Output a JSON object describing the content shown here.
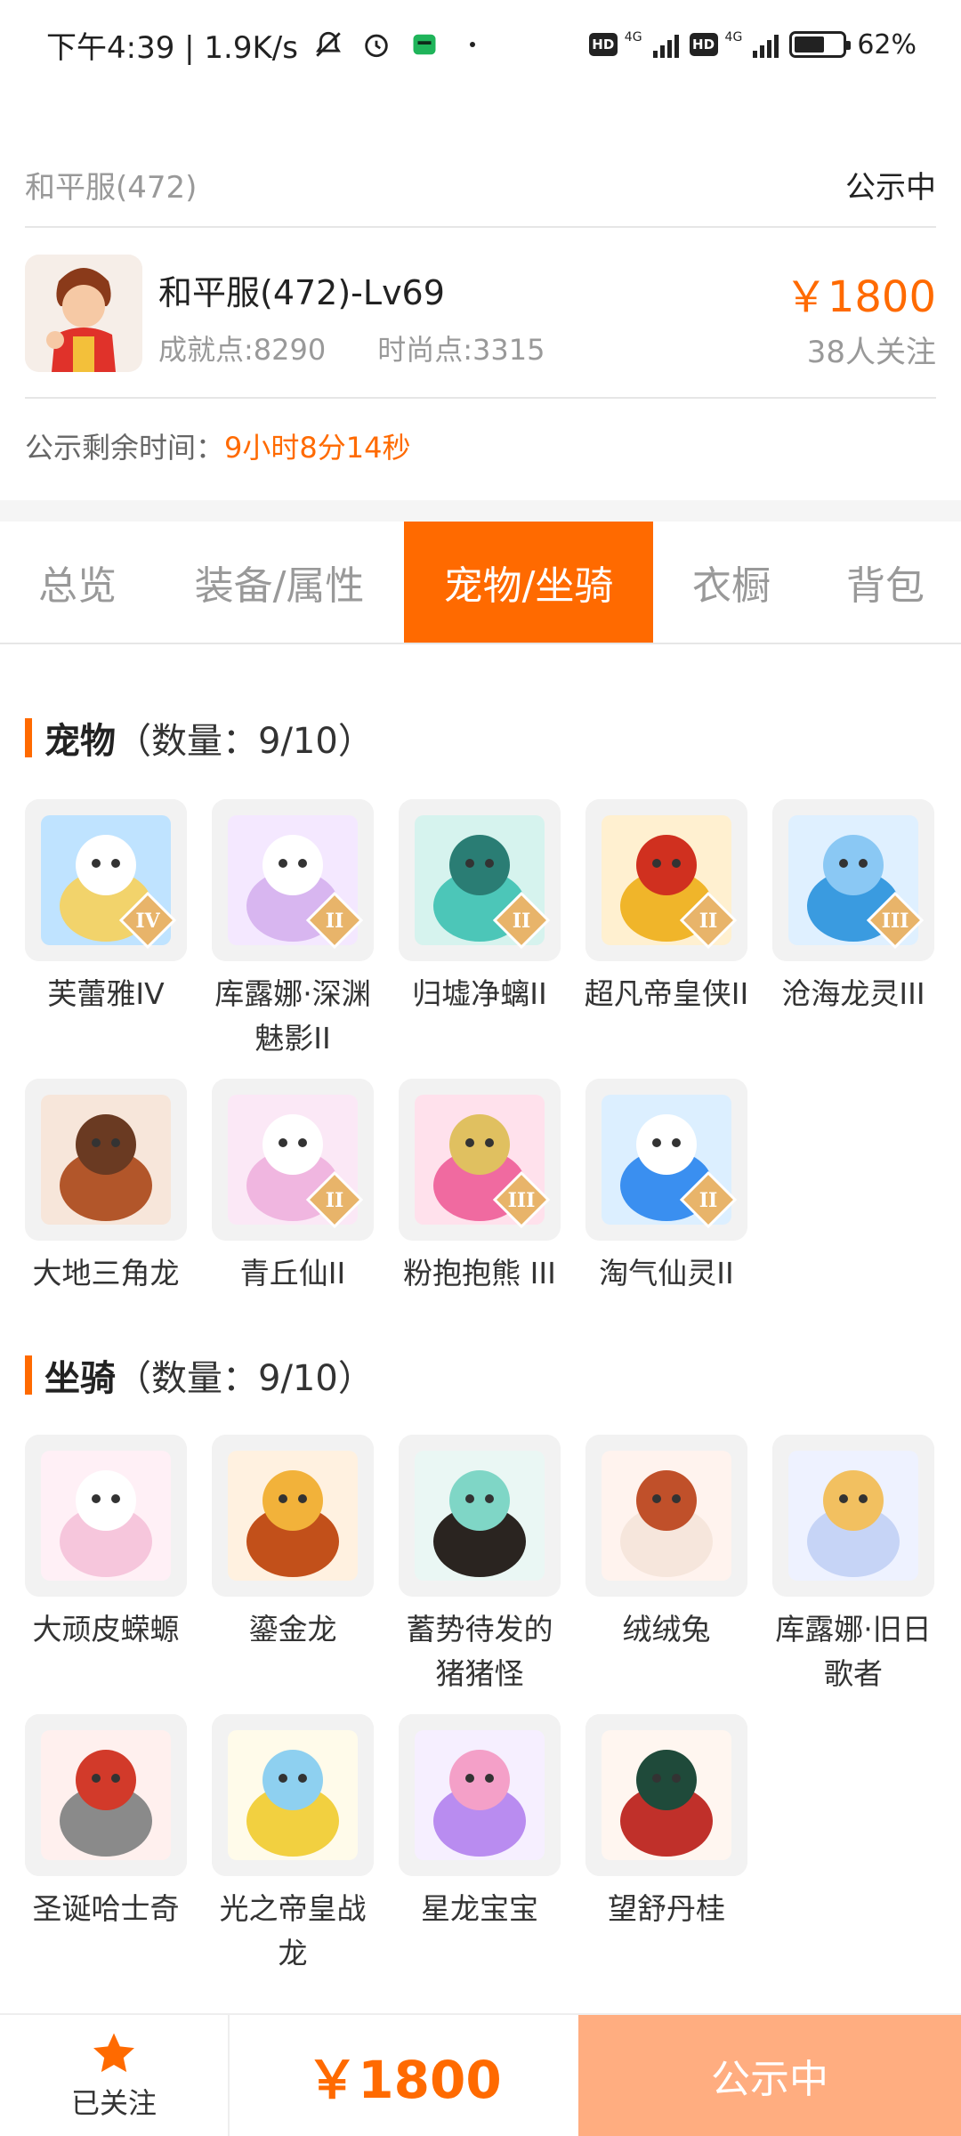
{
  "status_bar": {
    "time_speed": "下午4:39 | 1.9K/s",
    "hd1": "HD",
    "net1": "4G",
    "hd2": "HD",
    "net2": "4G",
    "battery_percent": "62%",
    "battery_level": 0.62,
    "icons": [
      "mute-bell-icon",
      "alarm-icon",
      "app-icon",
      "dot-icon"
    ]
  },
  "header": {
    "server_name": "和平服(472)",
    "status": "公示中",
    "character_title": "和平服(472)-Lv69",
    "achievement": "成就点:8290",
    "fashion": "时尚点:3315",
    "price": "￥1800",
    "followers": "38人关注",
    "timer_label": "公示剩余时间：",
    "timer_value": "9小时8分14秒"
  },
  "tabs": [
    {
      "label": "总览",
      "active": false
    },
    {
      "label": "装备/属性",
      "active": false
    },
    {
      "label": "宠物/坐骑",
      "active": true
    },
    {
      "label": "衣橱",
      "active": false
    },
    {
      "label": "背包",
      "active": false
    }
  ],
  "pets": {
    "title": "宠物",
    "count": "（数量：9/10）",
    "items": [
      {
        "name": "芙蕾雅IV",
        "tier": "IV"
      },
      {
        "name": "库露娜·深渊魅影II",
        "tier": "II"
      },
      {
        "name": "归墟净螭II",
        "tier": "II"
      },
      {
        "name": "超凡帝皇侠II",
        "tier": "II"
      },
      {
        "name": "沧海龙灵III",
        "tier": "III"
      },
      {
        "name": "大地三角龙",
        "tier": ""
      },
      {
        "name": "青丘仙II",
        "tier": "II"
      },
      {
        "name": "粉抱抱熊 III",
        "tier": "III"
      },
      {
        "name": "淘气仙灵II",
        "tier": "II"
      }
    ]
  },
  "mounts": {
    "title": "坐骑",
    "count": "（数量：9/10）",
    "items": [
      {
        "name": "大顽皮蝾螈"
      },
      {
        "name": "鎏金龙"
      },
      {
        "name": "蓄势待发的猪猪怪"
      },
      {
        "name": "绒绒兔"
      },
      {
        "name": "库露娜·旧日歌者"
      },
      {
        "name": "圣诞哈士奇"
      },
      {
        "name": "光之帝皇战龙"
      },
      {
        "name": "星龙宝宝"
      },
      {
        "name": "望舒丹桂"
      }
    ]
  },
  "bottom": {
    "follow_label": "已关注",
    "price": "￥1800",
    "cta": "公示中"
  },
  "colors": {
    "accent": "#ff6a00",
    "cta_bg": "#ffad80",
    "muted": "#999999"
  }
}
